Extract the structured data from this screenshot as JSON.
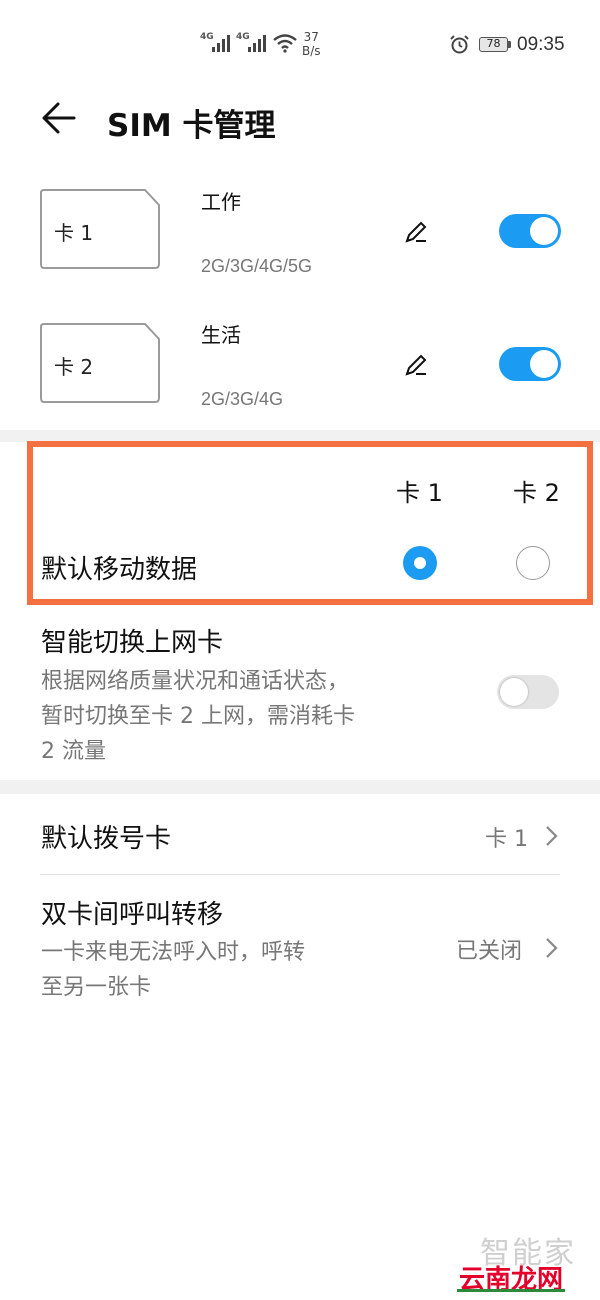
{
  "status_bar": {
    "signal1": "4G",
    "signal2": "4G",
    "speed_value": "37",
    "speed_unit": "B/s",
    "battery": "78",
    "time": "09:35"
  },
  "header": {
    "title": "SIM 卡管理"
  },
  "sims": [
    {
      "card_label": "卡 1",
      "name": "工作",
      "network": "2G/3G/4G/5G",
      "enabled": true
    },
    {
      "card_label": "卡 2",
      "name": "生活",
      "network": "2G/3G/4G",
      "enabled": true
    }
  ],
  "default_data": {
    "col1": "卡 1",
    "col2": "卡 2",
    "label": "默认移动数据",
    "selected": "卡 1"
  },
  "smart_switch": {
    "title": "智能切换上网卡",
    "desc_lines": [
      "根据网络质量状况和通话状态，",
      "暂时切换至卡 2 上网，需消耗卡",
      "2 流量"
    ],
    "enabled": false
  },
  "default_dial": {
    "label": "默认拨号卡",
    "value": "卡 1"
  },
  "call_forward": {
    "title": "双卡间呼叫转移",
    "desc_lines": [
      "一卡来电无法呼入时，呼转",
      "至另一张卡"
    ],
    "value": "已关闭"
  },
  "watermark": {
    "line1": "智能家",
    "line2": "云南龙网"
  },
  "colors": {
    "accent": "#1b9cf2",
    "highlight_border": "#f47040"
  }
}
